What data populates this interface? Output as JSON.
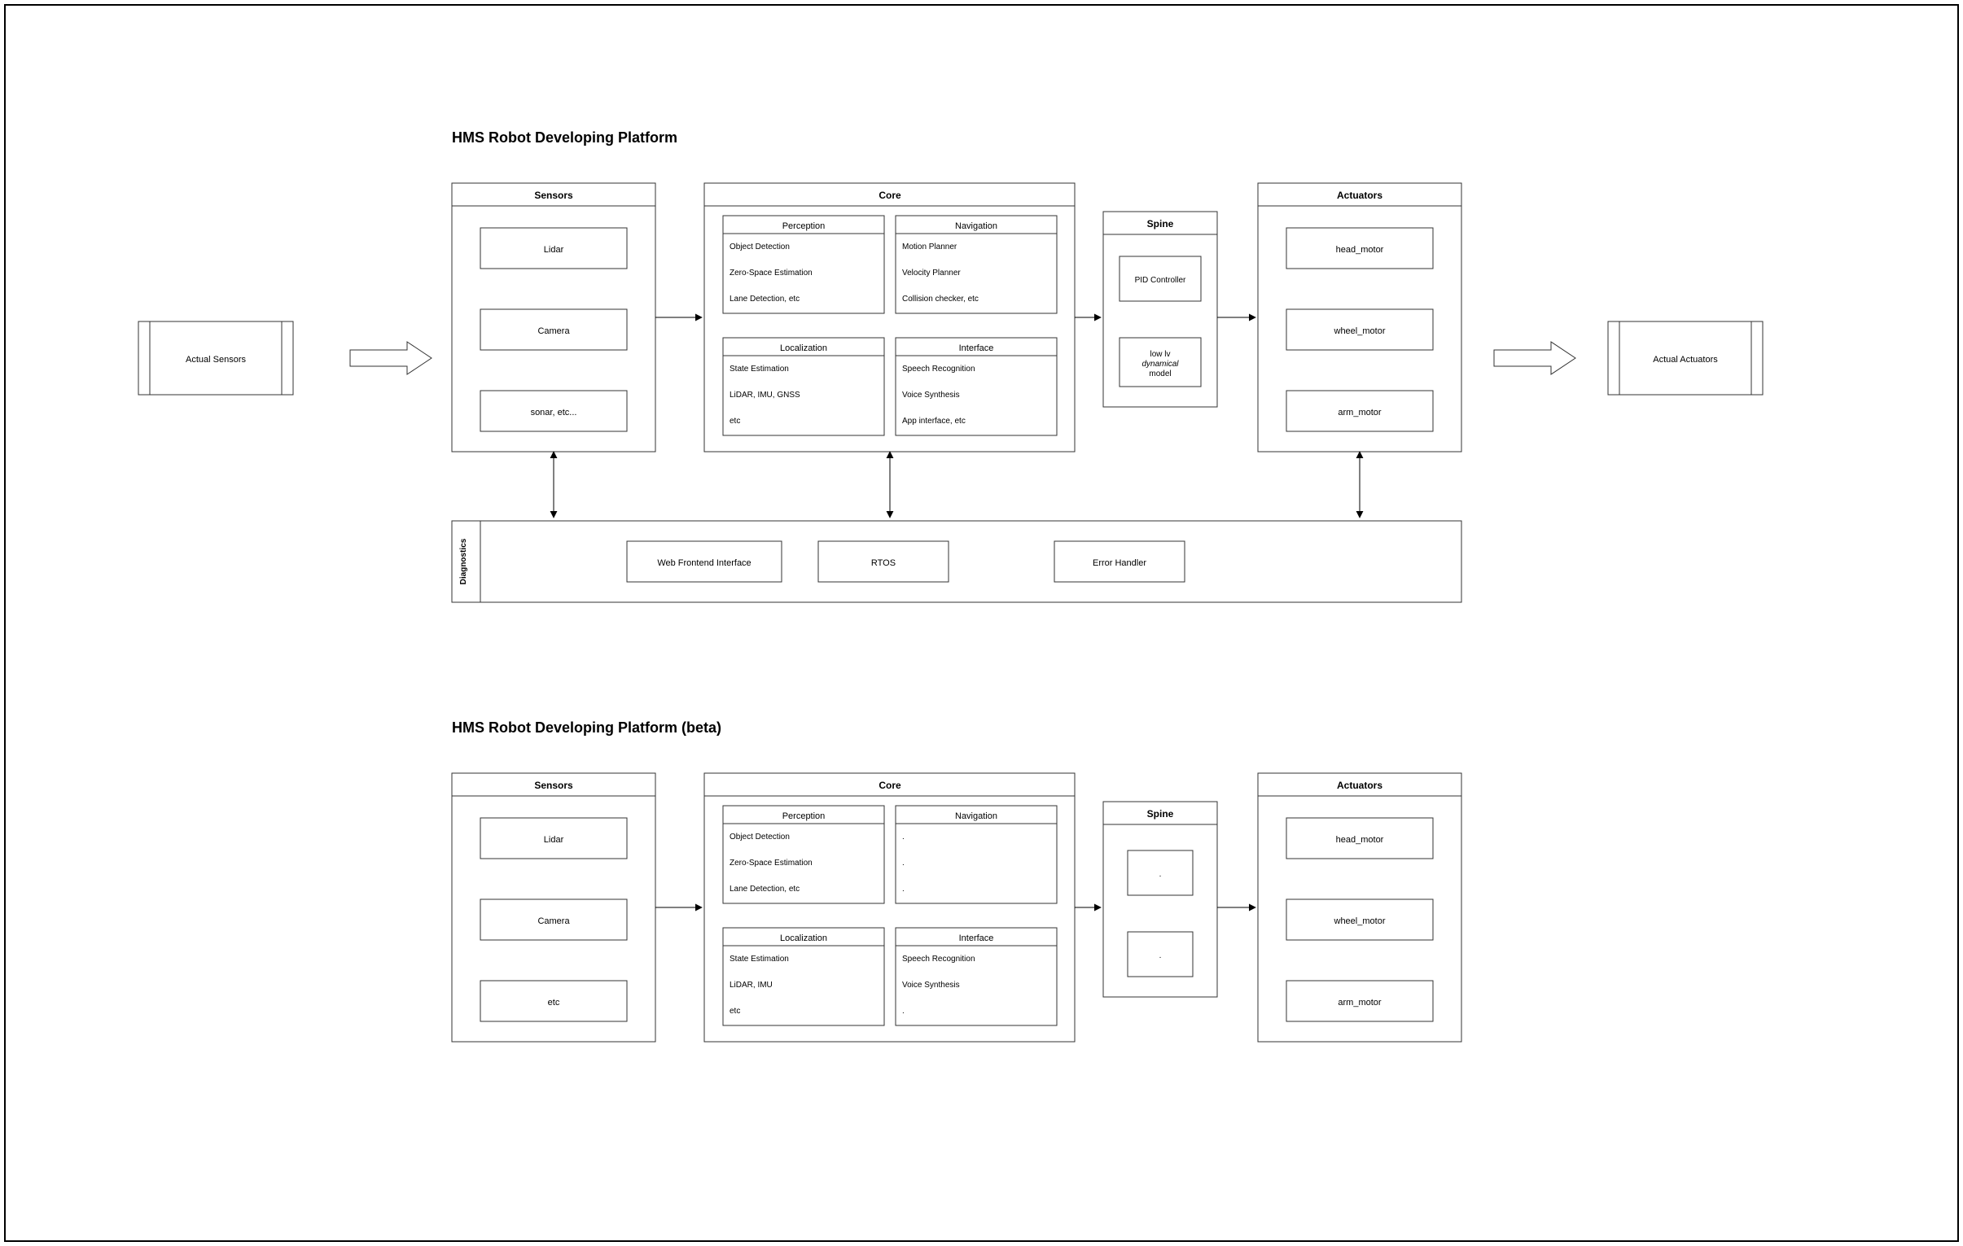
{
  "title1": "HMS Robot Developing Platform",
  "title2": "HMS Robot Developing Platform (beta)",
  "actual_sensors": "Actual Sensors",
  "actual_actuators": "Actual Actuators",
  "sensors": {
    "header": "Sensors",
    "items": [
      "Lidar",
      "Camera",
      "sonar, etc..."
    ]
  },
  "actuators": {
    "header": "Actuators",
    "items": [
      "head_motor",
      "wheel_motor",
      "arm_motor"
    ]
  },
  "spine": {
    "header": "Spine",
    "items": [
      "PID Controller",
      "low lv dynamical model"
    ]
  },
  "core": {
    "header": "Core",
    "perception": {
      "header": "Perception",
      "lines": [
        "Object Detection",
        "Zero-Space Estimation",
        "Lane Detection, etc"
      ]
    },
    "navigation": {
      "header": "Navigation",
      "lines": [
        "Motion Planner",
        "Velocity Planner",
        "Collision checker, etc"
      ]
    },
    "localization": {
      "header": "Localization",
      "lines": [
        "State Estimation",
        "LiDAR, IMU, GNSS",
        "etc"
      ]
    },
    "interface": {
      "header": "Interface",
      "lines": [
        "Speech Recognition",
        "Voice Synthesis",
        "App interface, etc"
      ]
    }
  },
  "diagnostics": {
    "header": "Diagnostics",
    "items": [
      "Web Frontend Interface",
      "RTOS",
      "Error Handler"
    ]
  },
  "beta": {
    "sensors": {
      "header": "Sensors",
      "items": [
        "Lidar",
        "Camera",
        "etc"
      ]
    },
    "actuators": {
      "header": "Actuators",
      "items": [
        "head_motor",
        "wheel_motor",
        "arm_motor"
      ]
    },
    "spine": {
      "header": "Spine",
      "items": [
        ".",
        "."
      ]
    },
    "core": {
      "header": "Core",
      "perception": {
        "header": "Perception",
        "lines": [
          "Object Detection",
          "Zero-Space Estimation",
          "Lane Detection, etc"
        ]
      },
      "navigation": {
        "header": "Navigation",
        "lines": [
          ".",
          ".",
          "."
        ]
      },
      "localization": {
        "header": "Localization",
        "lines": [
          "State Estimation",
          "LiDAR, IMU",
          "etc"
        ]
      },
      "interface": {
        "header": "Interface",
        "lines": [
          "Speech Recognition",
          "Voice Synthesis",
          "."
        ]
      }
    }
  }
}
